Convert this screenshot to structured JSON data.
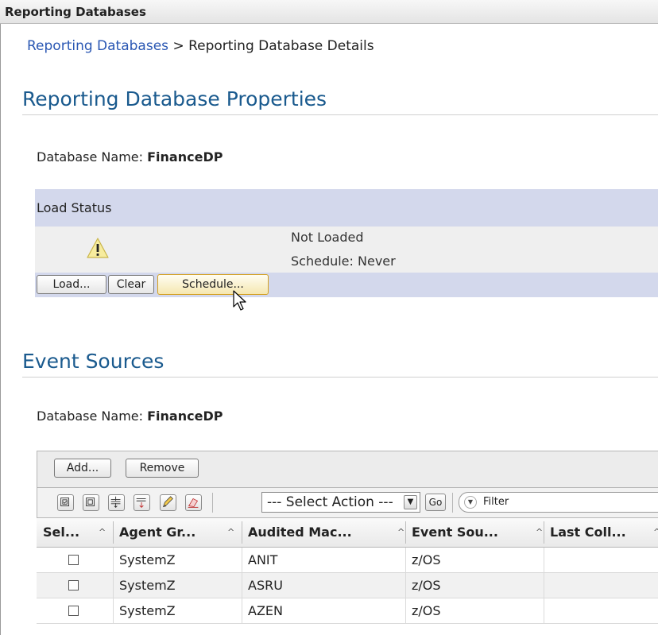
{
  "window": {
    "title": "Reporting Databases"
  },
  "breadcrumb": {
    "parent": "Reporting Databases",
    "separator": ">",
    "current": "Reporting Database Details"
  },
  "properties": {
    "title": "Reporting Database Properties",
    "db_label": "Database Name:",
    "db_value": "FinanceDP"
  },
  "load_status": {
    "header": "Load Status",
    "state": "Not Loaded",
    "schedule": "Schedule: Never",
    "warning_icon": "warning-triangle-icon",
    "buttons": {
      "load": "Load...",
      "clear": "Clear",
      "schedule": "Schedule..."
    }
  },
  "event_sources": {
    "title": "Event Sources",
    "db_label": "Database Name:",
    "db_value": "FinanceDP",
    "buttons": {
      "add": "Add...",
      "remove": "Remove"
    },
    "toolbar_icons": [
      "select-all-icon",
      "deselect-all-icon",
      "expand-filter-icon",
      "collapse-filter-icon",
      "edit-sort-icon",
      "clear-sort-icon"
    ],
    "action_select": "--- Select Action ---",
    "go": "Go",
    "filter": "Filter",
    "columns": [
      "Sel...",
      "Agent Gr...",
      "Audited Mac...",
      "Event Sou...",
      "Last Coll..."
    ],
    "rows": [
      {
        "agent_group": "SystemZ",
        "audited_machine": "ANIT",
        "event_source": "z/OS",
        "last_collected": ""
      },
      {
        "agent_group": "SystemZ",
        "audited_machine": "ASRU",
        "event_source": "z/OS",
        "last_collected": ""
      },
      {
        "agent_group": "SystemZ",
        "audited_machine": "AZEN",
        "event_source": "z/OS",
        "last_collected": ""
      }
    ]
  },
  "colors": {
    "heading": "#1a5a8e",
    "link": "#2a57b3",
    "status_band": "#d3d8ec"
  }
}
